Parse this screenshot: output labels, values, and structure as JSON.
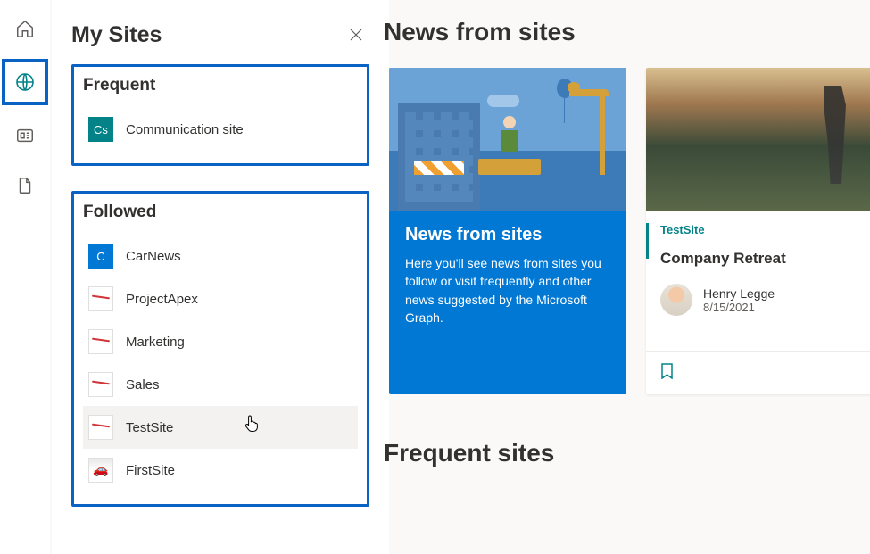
{
  "panel": {
    "title": "My Sites",
    "frequent": {
      "heading": "Frequent",
      "items": [
        {
          "thumb_text": "Cs",
          "label": "Communication site"
        }
      ]
    },
    "followed": {
      "heading": "Followed",
      "items": [
        {
          "thumb_text": "C",
          "label": "CarNews"
        },
        {
          "thumb_text": "",
          "label": "ProjectApex"
        },
        {
          "thumb_text": "",
          "label": "Marketing"
        },
        {
          "thumb_text": "",
          "label": "Sales"
        },
        {
          "thumb_text": "",
          "label": "TestSite"
        },
        {
          "thumb_text": "",
          "label": "FirstSite"
        }
      ]
    }
  },
  "main": {
    "news_heading": "News from sites",
    "info_card": {
      "title": "News from sites",
      "text": "Here you'll see news from sites you follow or visit frequently and other news suggested by the Microsoft Graph."
    },
    "article": {
      "site_label": "TestSite",
      "title": "Company Retreat",
      "author_name": "Henry Legge",
      "author_date": "8/15/2021"
    },
    "frequent_heading": "Frequent sites"
  }
}
